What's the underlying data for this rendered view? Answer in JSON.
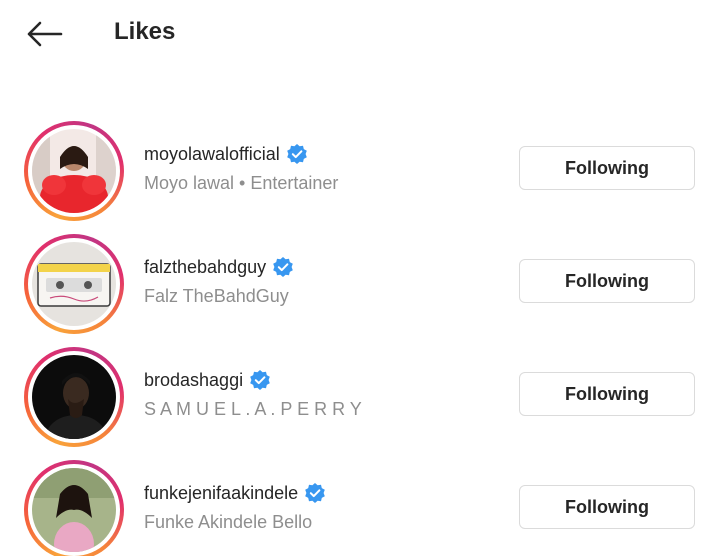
{
  "header": {
    "title": "Likes"
  },
  "colors": {
    "verified": "#3897f0",
    "secondary_text": "#8e8e8e",
    "button_border": "#dbdbdb"
  },
  "list": {
    "partial_top_button_label": "",
    "items": [
      {
        "username": "moyolawalofficial",
        "subtitle": "Moyo lawal • Entertainer",
        "verified": true,
        "button": "Following"
      },
      {
        "username": "falzthebahdguy",
        "subtitle": "Falz TheBahdGuy",
        "verified": true,
        "button": "Following"
      },
      {
        "username": "brodashaggi",
        "subtitle": "S A M U E L . A . P E R R Y",
        "verified": true,
        "button": "Following"
      },
      {
        "username": "funkejenifaakindele",
        "subtitle": "Funke Akindele Bello",
        "verified": true,
        "button": "Following"
      }
    ]
  }
}
